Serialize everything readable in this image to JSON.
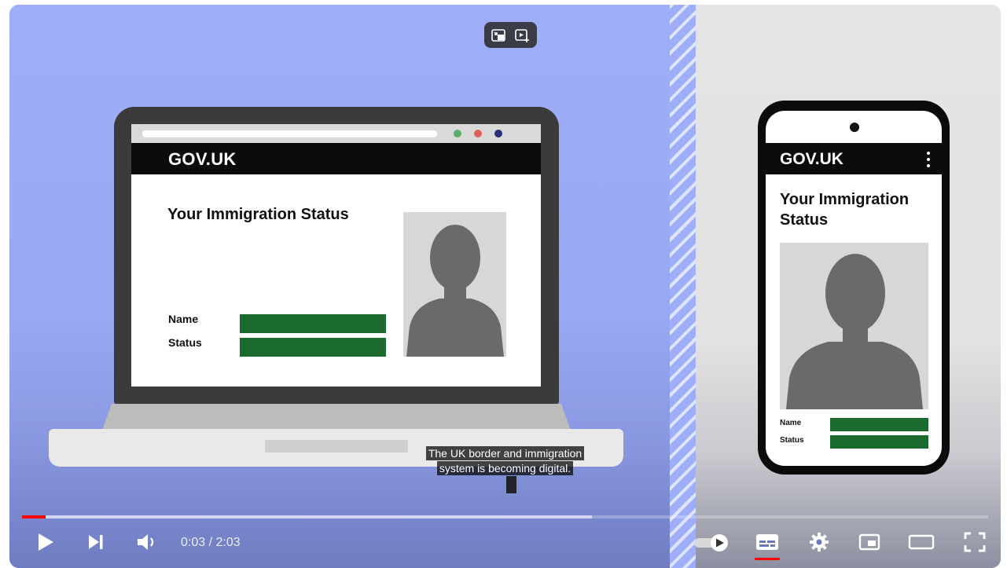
{
  "laptop": {
    "logo": "GOV.UK",
    "heading": "Your Immigration Status",
    "name_label": "Name",
    "status_label": "Status",
    "dot_colors": [
      "#5aae6c",
      "#e0605a",
      "#2b2f78"
    ]
  },
  "phone": {
    "logo": "GOV.UK",
    "heading": "Your Immigration Status",
    "name_label": "Name",
    "status_label": "Status"
  },
  "caption": {
    "line1": "The UK border and immigration",
    "line2": "system is becoming digital."
  },
  "player": {
    "current_time": "0:03",
    "separator": " / ",
    "duration": "2:03",
    "progress_fraction": 0.0244,
    "buffered_fraction": 0.59,
    "accent_color": "#ff0000",
    "autoplay_on": true,
    "captions_on": true
  },
  "icons": {
    "top_overlay": [
      "cast-to-device-icon",
      "add-to-queue-icon"
    ],
    "controls": [
      "play-icon",
      "next-icon",
      "volume-icon",
      "autoplay-toggle-icon",
      "subtitles-icon",
      "settings-gear-icon",
      "miniplayer-icon",
      "theater-mode-icon",
      "fullscreen-icon"
    ]
  }
}
